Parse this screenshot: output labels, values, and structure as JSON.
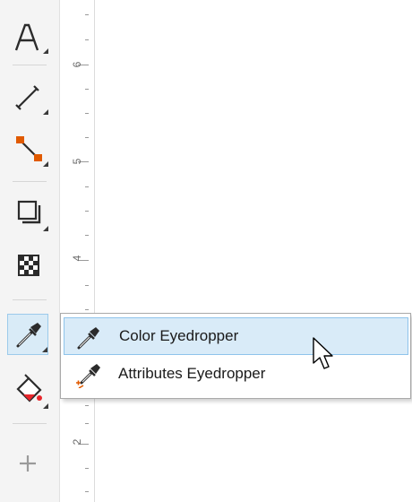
{
  "toolbox": {
    "tools": [
      {
        "name": "text-tool",
        "icon": "text-a-icon"
      },
      {
        "name": "line-tool",
        "icon": "dimension-line-icon"
      },
      {
        "name": "connector-tool",
        "icon": "connector-icon"
      },
      {
        "name": "drop-shadow-tool",
        "icon": "drop-shadow-icon"
      },
      {
        "name": "transparency-tool",
        "icon": "checkerboard-icon"
      },
      {
        "name": "eyedropper-tool",
        "icon": "eyedropper-icon",
        "active": true
      },
      {
        "name": "interactive-fill-tool",
        "icon": "paint-bucket-icon"
      },
      {
        "name": "add-tool",
        "icon": "plus-icon"
      }
    ]
  },
  "ruler": {
    "labels": [
      "6",
      "5",
      "4",
      "2"
    ]
  },
  "flyout": {
    "items": [
      {
        "label": "Color Eyedropper",
        "icon": "eyedropper-icon",
        "hovered": true
      },
      {
        "label": "Attributes Eyedropper",
        "icon": "attributes-eyedropper-icon",
        "hovered": false
      }
    ]
  },
  "colors": {
    "accent_hover": "#d9ebf8",
    "accent_border": "#8ec3eb",
    "fill_red": "#e8262c",
    "node_orange": "#e05a00"
  }
}
